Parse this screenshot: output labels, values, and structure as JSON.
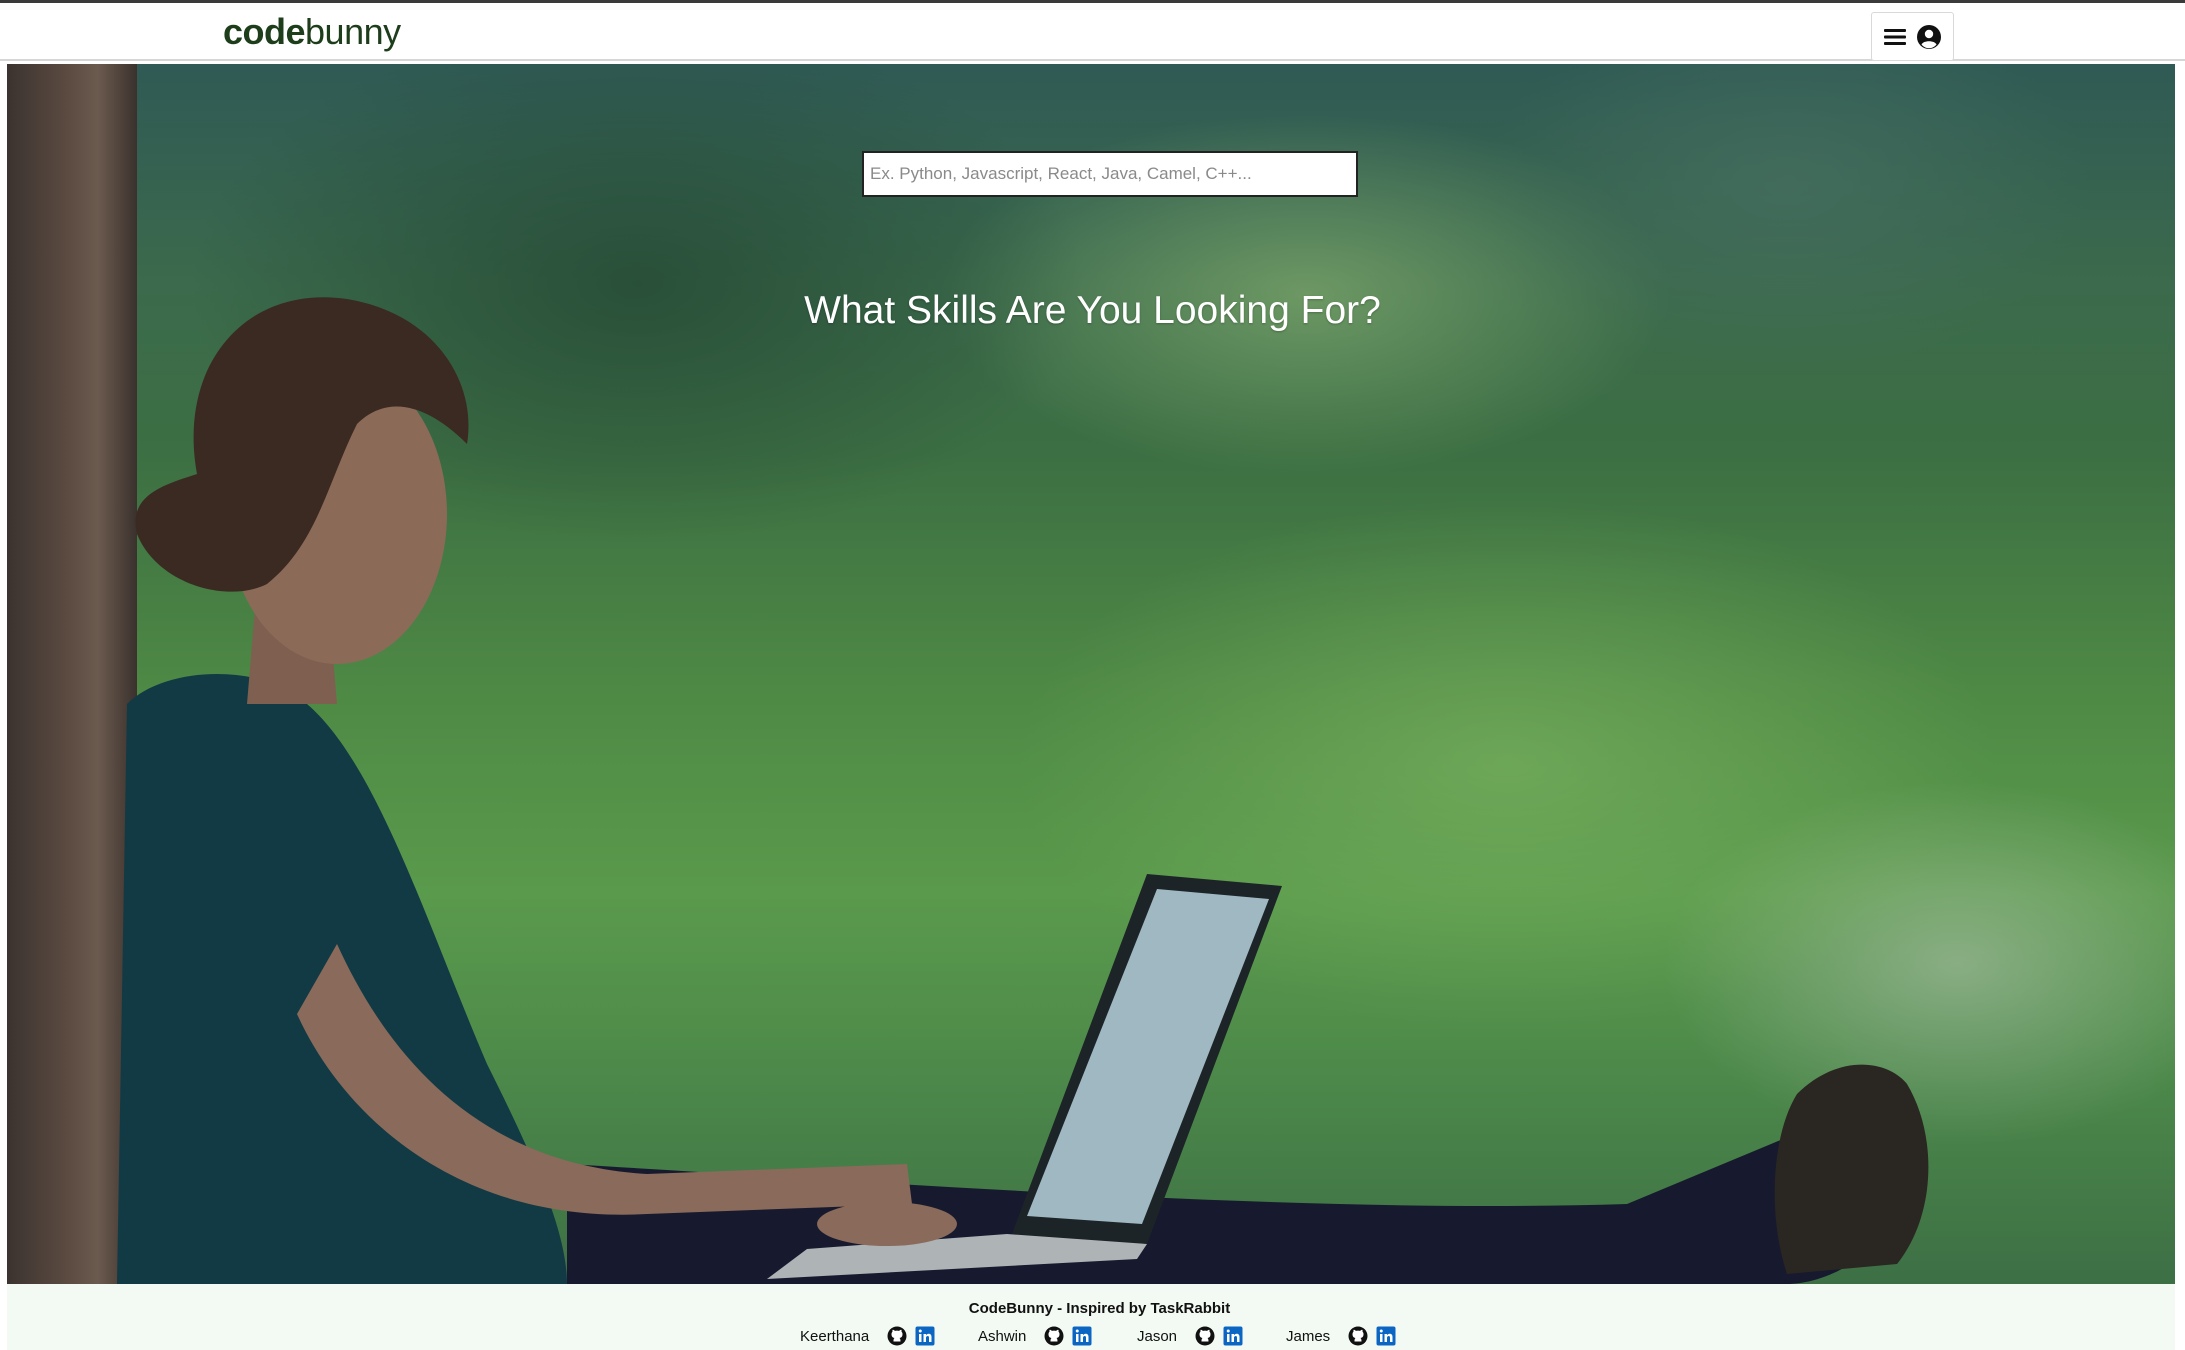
{
  "header": {
    "logo_bold": "code",
    "logo_light": "bunny",
    "menu_icon": "hamburger-menu-icon",
    "user_icon": "user-circle-icon"
  },
  "hero": {
    "search_placeholder": "Ex. Python, Javascript, React, Java, Camel, C++...",
    "title": "What Skills Are You Looking For?",
    "background_image": "woman with laptop overlooking green mountain valley"
  },
  "footer": {
    "title": "CodeBunny - Inspired by TaskRabbit",
    "contributors": [
      {
        "name": "Keerthana",
        "icons": [
          "github-icon",
          "linkedin-icon"
        ]
      },
      {
        "name": "Ashwin",
        "icons": [
          "github-icon",
          "linkedin-icon"
        ]
      },
      {
        "name": "Jason",
        "icons": [
          "github-icon",
          "linkedin-icon"
        ]
      },
      {
        "name": "James",
        "icons": [
          "github-icon",
          "linkedin-icon"
        ]
      }
    ]
  },
  "colors": {
    "logo": "#1d3d1b",
    "footer_bg": "#f3faf3",
    "linkedin": "#0a66c2"
  }
}
